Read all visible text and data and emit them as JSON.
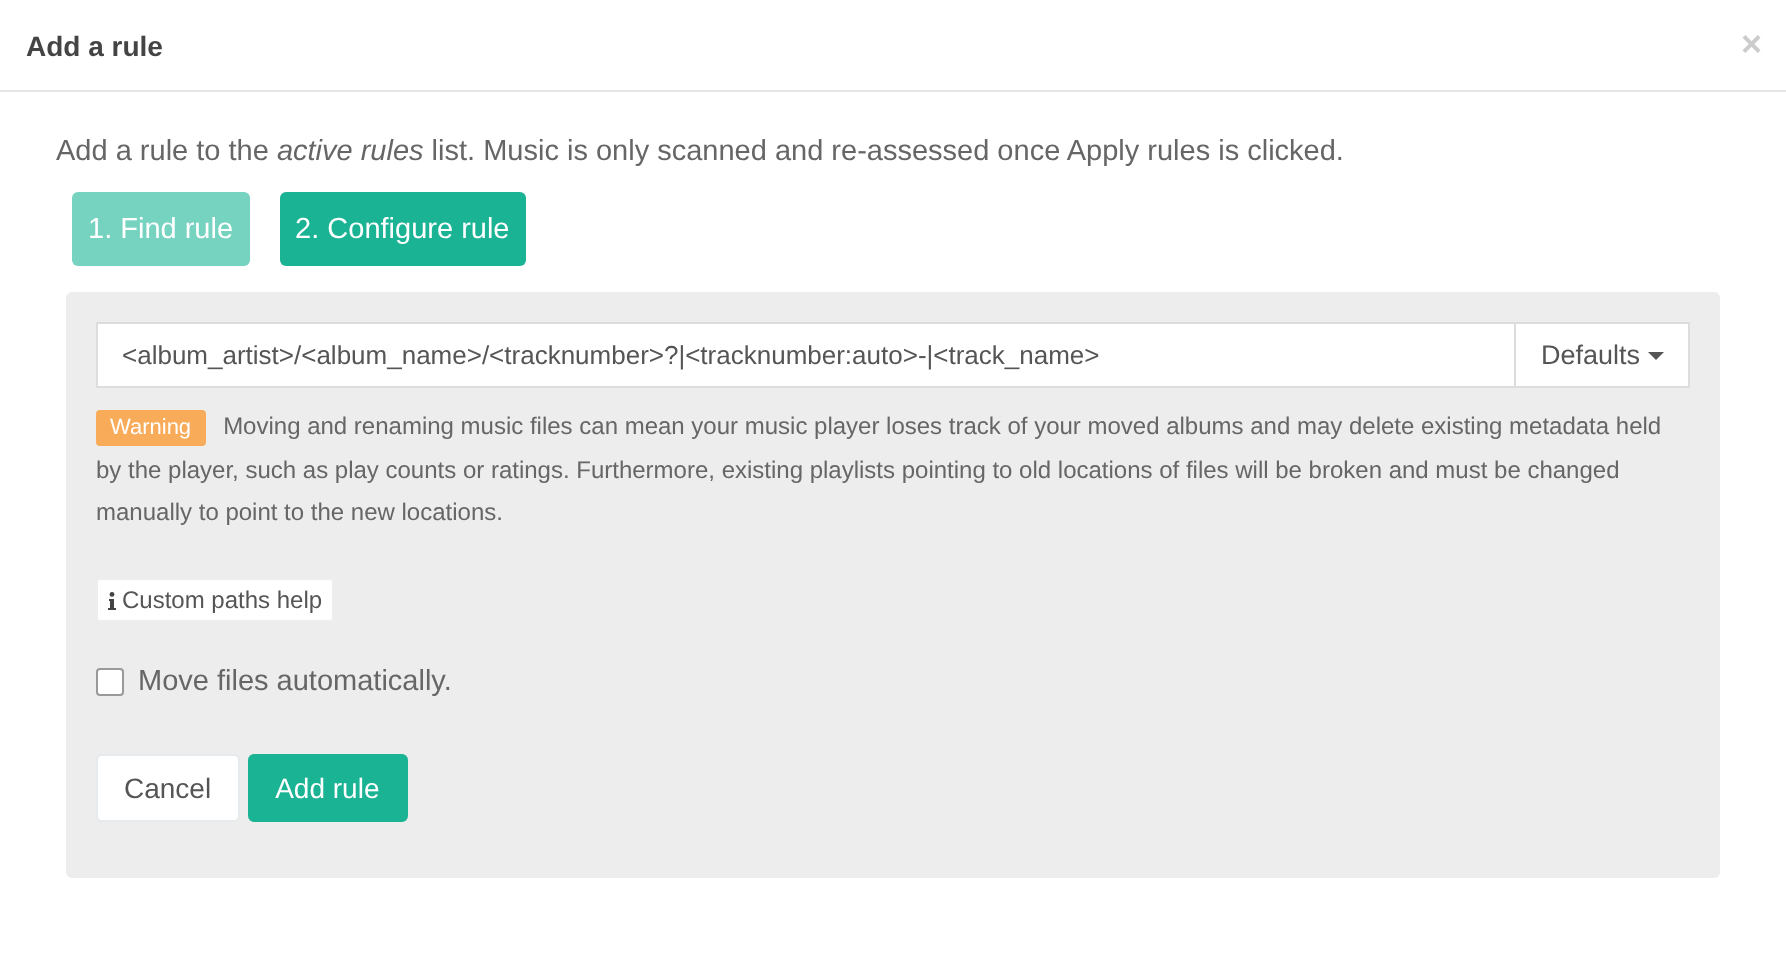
{
  "dialog": {
    "title": "Add a rule",
    "close": "×"
  },
  "intro": "Add a rule to the *active rules* list. Music is only scanned and re-assessed once Apply rules is clicked.",
  "steps": [
    {
      "label": "1. Find rule",
      "selected": false
    },
    {
      "label": "2. Configure rule",
      "selected": true
    }
  ],
  "path_field": {
    "value": "<album_artist>/<album_name>/<tracknumber>?|<tracknumber:auto>-|<track_name>",
    "dropdown": "Defaults"
  },
  "warning": {
    "badge": "Warning",
    "text": "Moving and renaming music files can mean your music player loses track of your moved albums and may delete existing metadata held by the player, such as play counts or ratings. Furthermore, existing playlists pointing to old locations of files will be broken and must be changed manually to point to the new locations."
  },
  "help_button": "Custom paths help",
  "move_files": {
    "label": "Move files automatically.",
    "checked": false
  },
  "buttons": [
    {
      "label": "Cancel",
      "kind": "default"
    },
    {
      "label": "Add rule",
      "kind": "primary"
    }
  ]
}
